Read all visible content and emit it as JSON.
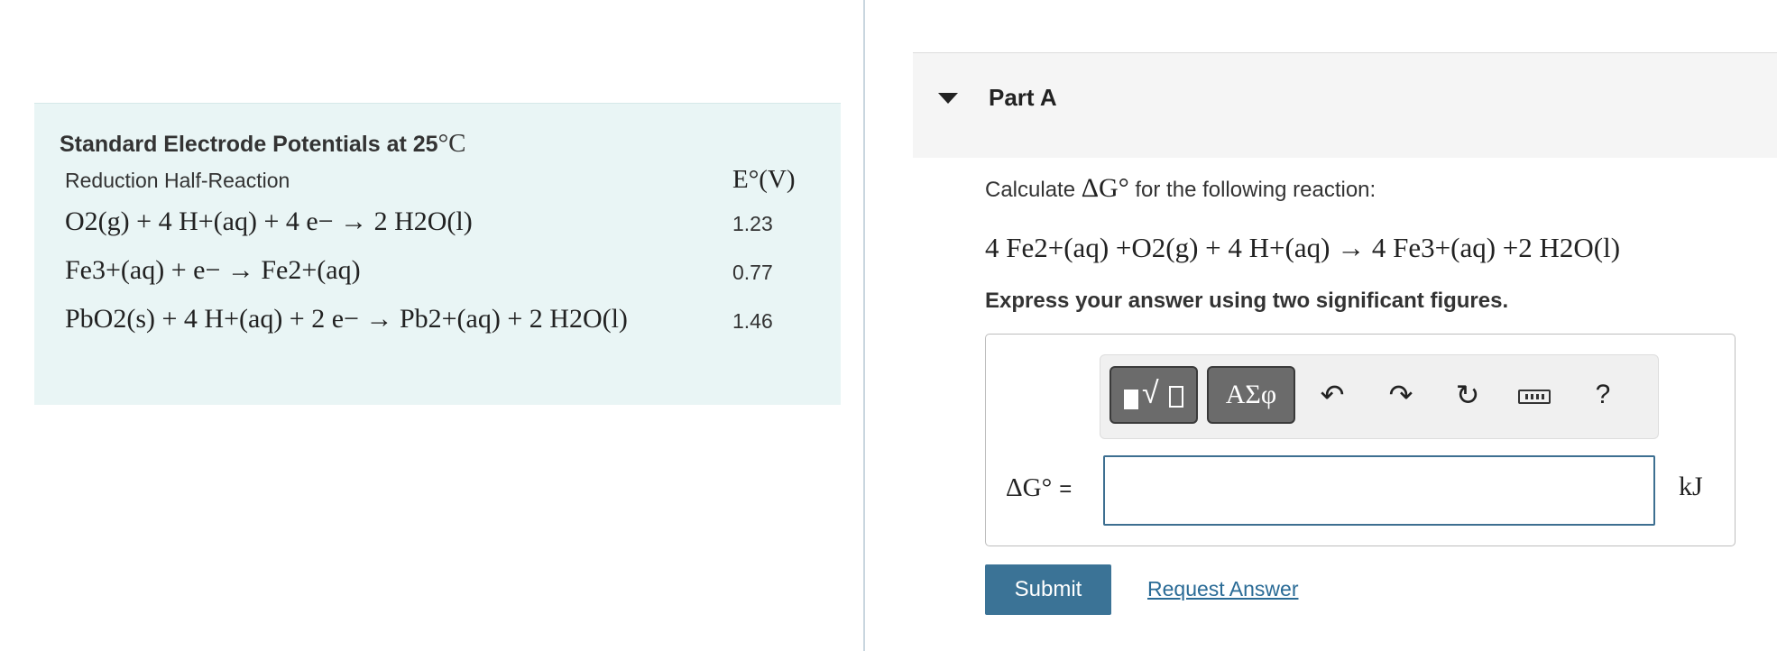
{
  "table": {
    "title": "Standard Electrode Potentials at 25",
    "title_unit": "°C",
    "col_reaction": "Reduction Half-Reaction",
    "col_potential": "E°(V)",
    "rows": [
      {
        "reaction": "O2(g) + 4 H+(aq) + 4 e− → 2 H2O(l)",
        "value": "1.23"
      },
      {
        "reaction": "Fe3+(aq) + e− → Fe2+(aq)",
        "value": "0.77"
      },
      {
        "reaction": "PbO2(s) + 4 H+(aq) + 2 e− → Pb2+(aq) + 2 H2O(l)",
        "value": "1.46"
      }
    ]
  },
  "part": {
    "title": "Part A",
    "prompt_before": "Calculate",
    "prompt_symbol": "ΔG°",
    "prompt_after": "for the following reaction:",
    "equation": "4 Fe2+(aq) +O2(g) + 4 H+(aq) → 4 Fe3+(aq) +2 H2O(l)",
    "instructions": "Express your answer using two significant figures."
  },
  "answer": {
    "symbols_label": "ΑΣφ",
    "undo_icon": "↶",
    "redo_icon": "↷",
    "reset_icon": "↻",
    "help_label": "?",
    "label": "ΔG°",
    "equals": "=",
    "value": "",
    "unit": "kJ"
  },
  "actions": {
    "submit_label": "Submit",
    "request_answer_label": "Request Answer"
  }
}
